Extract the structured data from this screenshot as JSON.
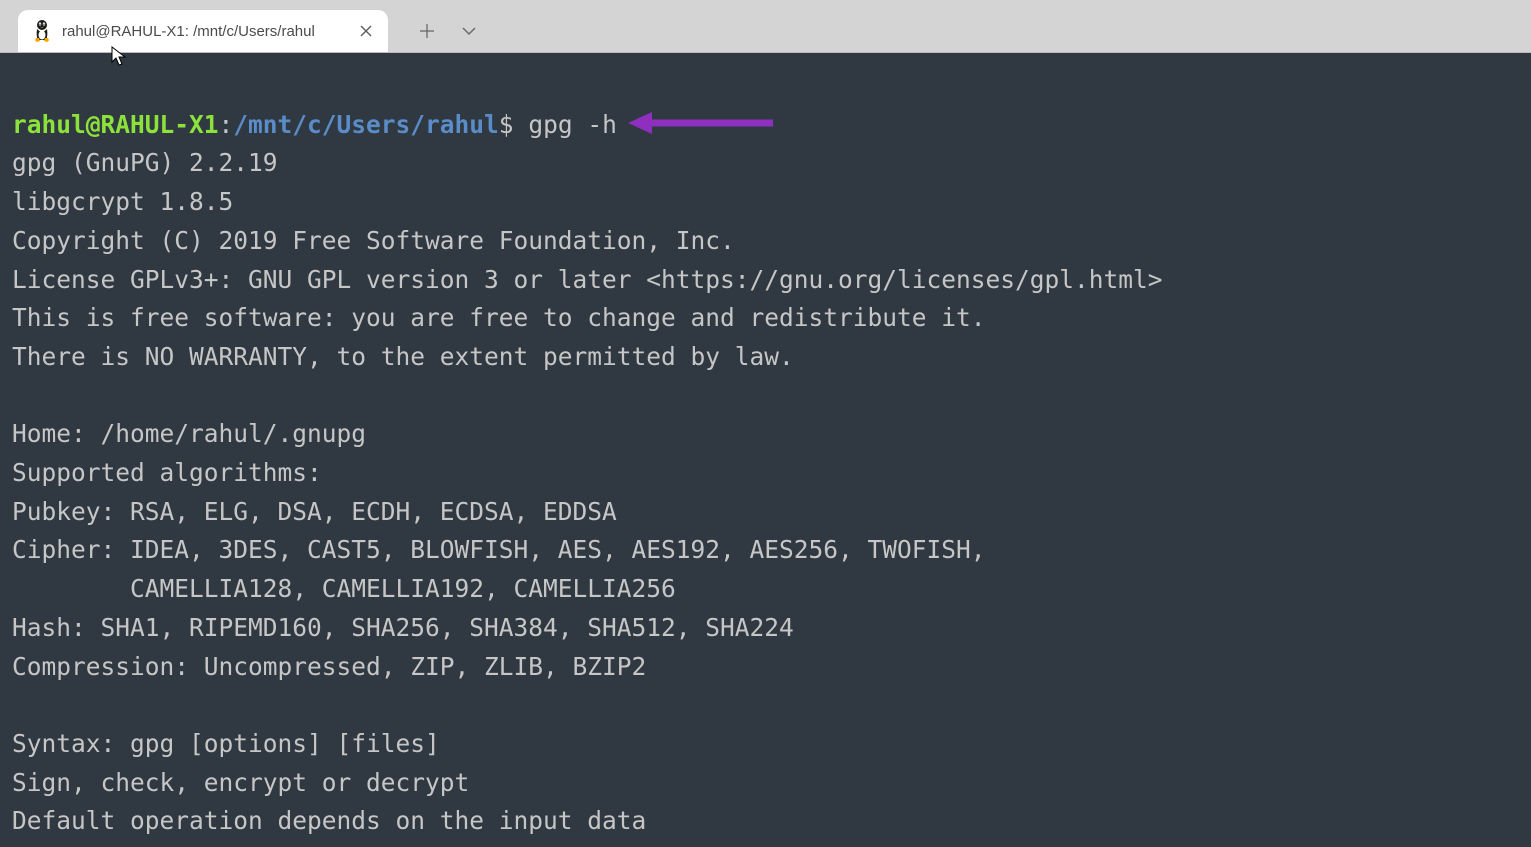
{
  "tab": {
    "title": "rahul@RAHUL-X1: /mnt/c/Users/rahul"
  },
  "prompt": {
    "user": "rahul@RAHUL-X1",
    "colon": ":",
    "path": "/mnt/c/Users/rahul",
    "dollar": "$",
    "command": "gpg -h"
  },
  "output": {
    "l1": "gpg (GnuPG) 2.2.19",
    "l2": "libgcrypt 1.8.5",
    "l3": "Copyright (C) 2019 Free Software Foundation, Inc.",
    "l4": "License GPLv3+: GNU GPL version 3 or later <https://gnu.org/licenses/gpl.html>",
    "l5": "This is free software: you are free to change and redistribute it.",
    "l6": "There is NO WARRANTY, to the extent permitted by law.",
    "blank1": " ",
    "l7": "Home: /home/rahul/.gnupg",
    "l8": "Supported algorithms:",
    "l9": "Pubkey: RSA, ELG, DSA, ECDH, ECDSA, EDDSA",
    "l10": "Cipher: IDEA, 3DES, CAST5, BLOWFISH, AES, AES192, AES256, TWOFISH,",
    "l11": "        CAMELLIA128, CAMELLIA192, CAMELLIA256",
    "l12": "Hash: SHA1, RIPEMD160, SHA256, SHA384, SHA512, SHA224",
    "l13": "Compression: Uncompressed, ZIP, ZLIB, BZIP2",
    "blank2": " ",
    "l14": "Syntax: gpg [options] [files]",
    "l15": "Sign, check, encrypt or decrypt",
    "l16": "Default operation depends on the input data"
  },
  "colors": {
    "annotationArrow": "#8e2fc0"
  }
}
